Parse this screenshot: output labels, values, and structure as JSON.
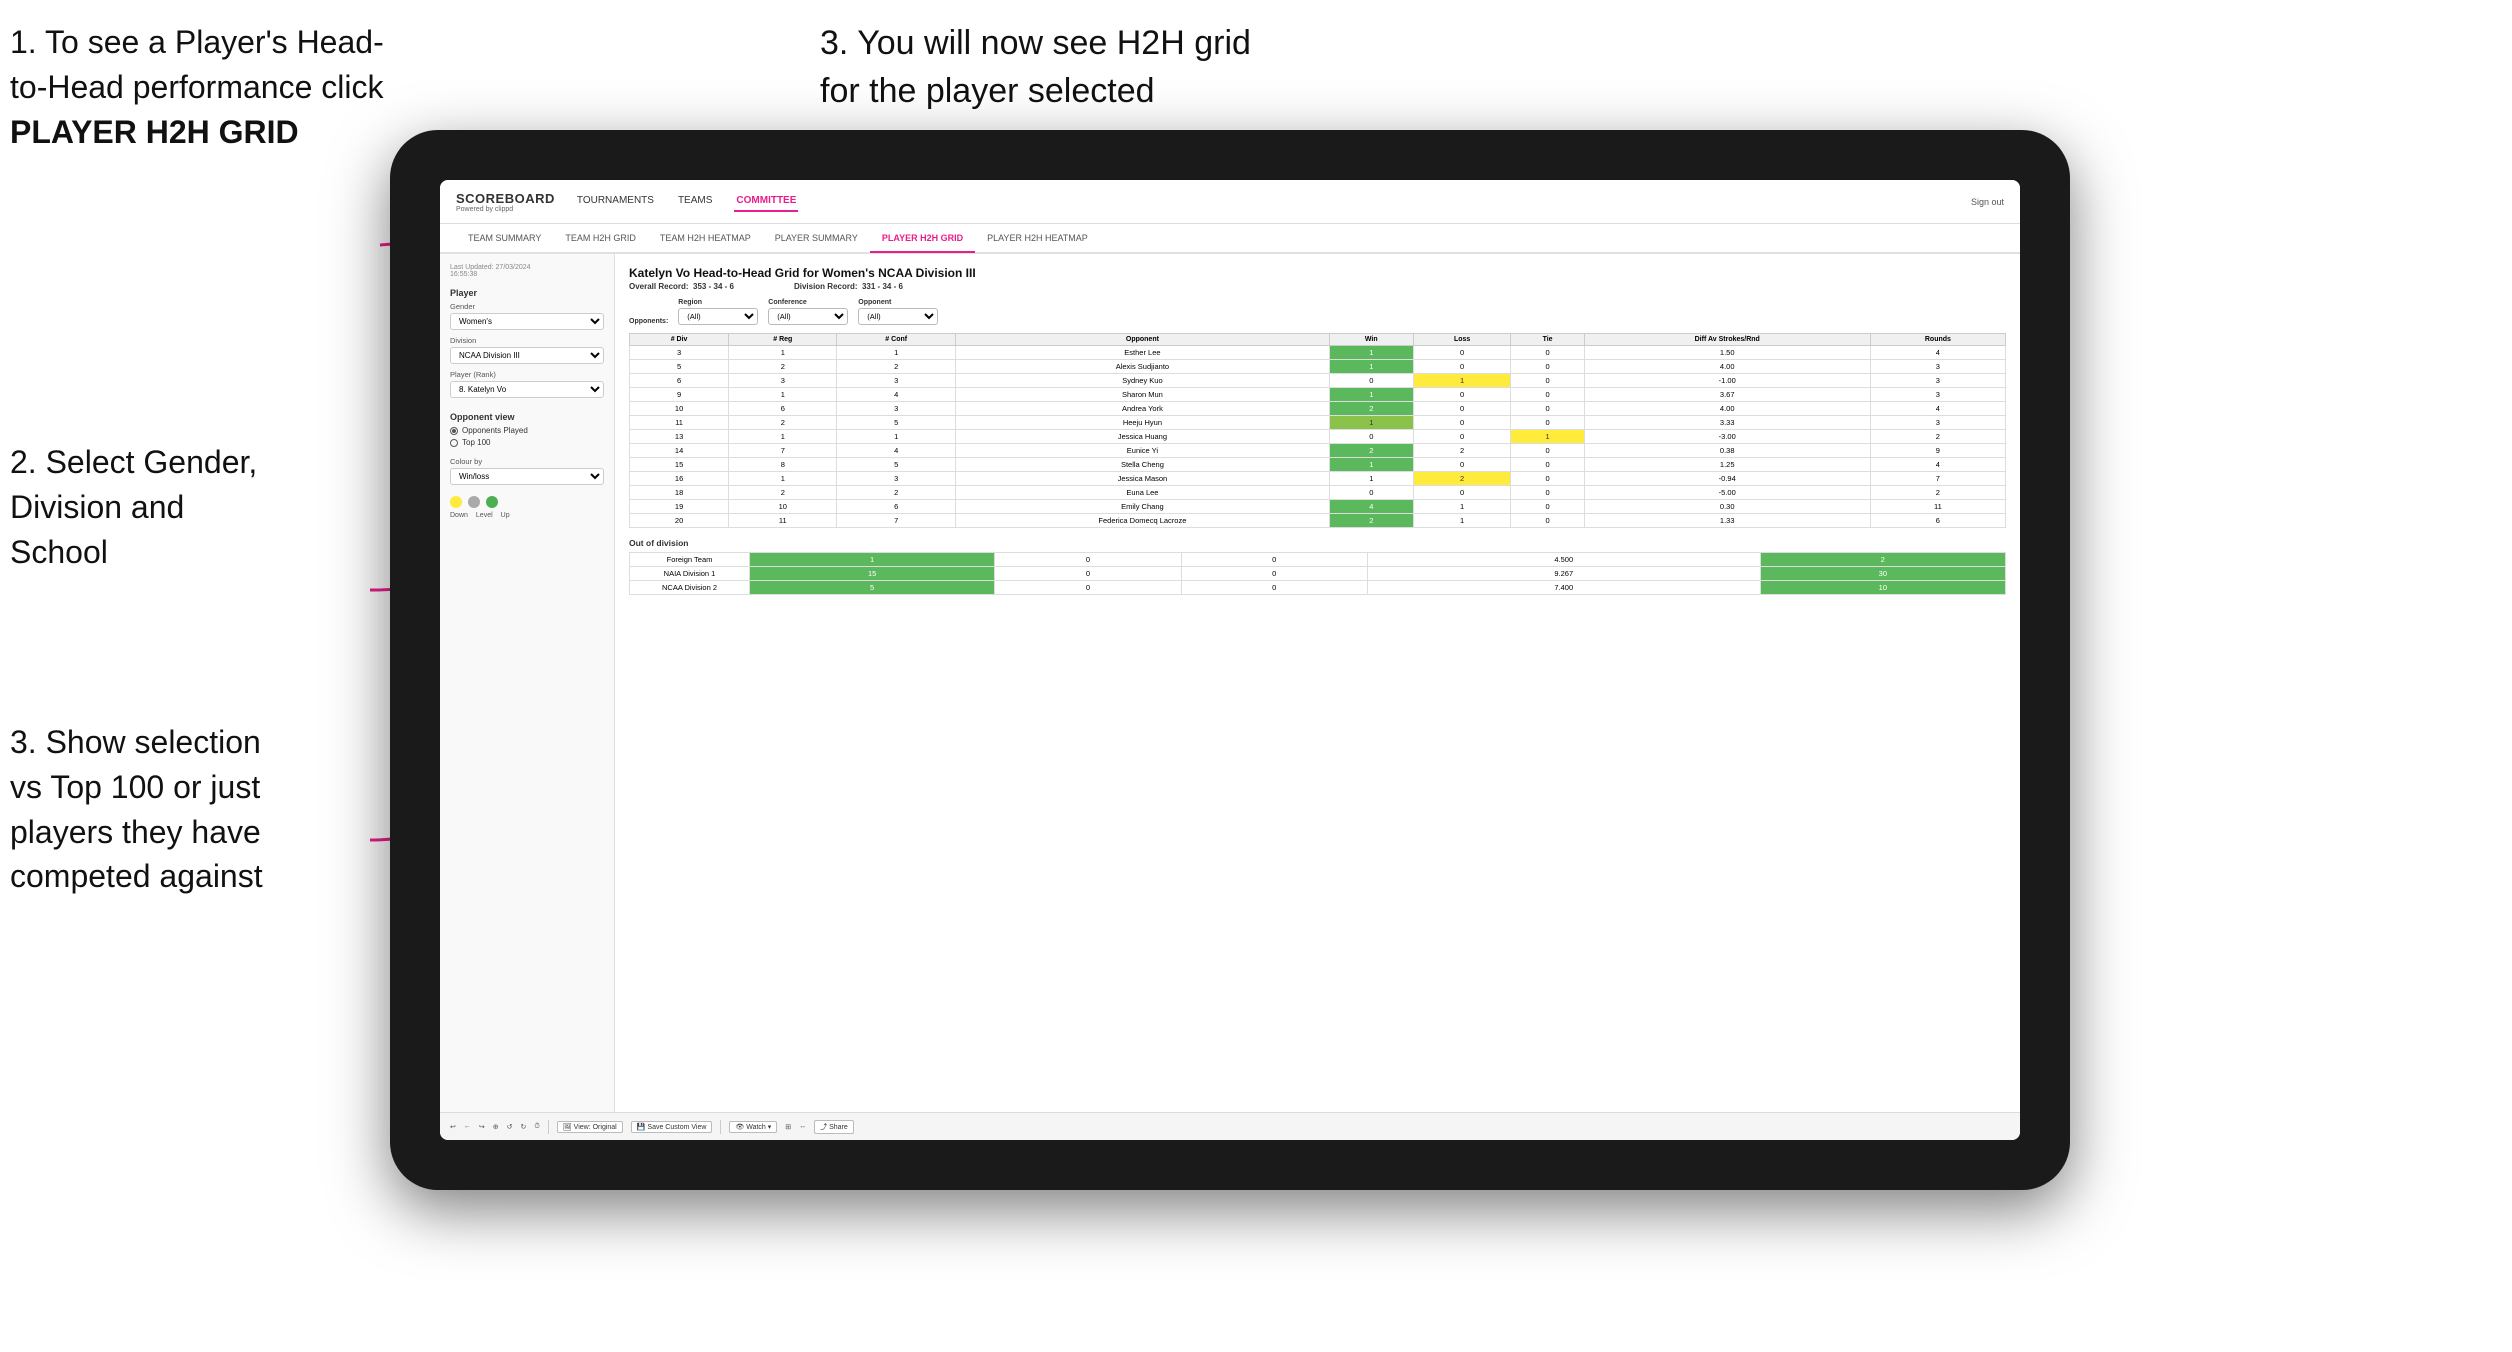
{
  "annotations": {
    "top_left": {
      "line1": "1. To see a Player's Head-",
      "line2": "to-Head performance click",
      "line3": "PLAYER H2H GRID"
    },
    "top_right": {
      "line1": "3. You will now see H2H grid",
      "line2": "for the player selected"
    },
    "mid_left": {
      "text": "2. Select Gender,\nDivision and\nSchool"
    },
    "bottom_left": {
      "line1": "3. Show selection",
      "line2": "vs Top 100 or just",
      "line3": "players they have",
      "line4": "competed against"
    }
  },
  "navbar": {
    "logo": "SCOREBOARD",
    "logo_sub": "Powered by clippd",
    "links": [
      "TOURNAMENTS",
      "TEAMS",
      "COMMITTEE"
    ],
    "active_link": "COMMITTEE",
    "sign_out": "Sign out"
  },
  "subnav": {
    "links": [
      "TEAM SUMMARY",
      "TEAM H2H GRID",
      "TEAM H2H HEATMAP",
      "PLAYER SUMMARY",
      "PLAYER H2H GRID",
      "PLAYER H2H HEATMAP"
    ],
    "active": "PLAYER H2H GRID"
  },
  "sidebar": {
    "timestamp": "Last Updated: 27/03/2024\n16:55:38",
    "player_section": "Player",
    "gender_label": "Gender",
    "gender_value": "Women's",
    "division_label": "Division",
    "division_value": "NCAA Division III",
    "player_rank_label": "Player (Rank)",
    "player_rank_value": "8. Katelyn Vo",
    "opponent_view_title": "Opponent view",
    "radio_options": [
      "Opponents Played",
      "Top 100"
    ],
    "radio_selected": "Opponents Played",
    "colour_by_label": "Colour by",
    "colour_by_value": "Win/loss",
    "legend_down": "Down",
    "legend_level": "Level",
    "legend_up": "Up"
  },
  "main": {
    "title": "Katelyn Vo Head-to-Head Grid for Women's NCAA Division III",
    "overall_record_label": "Overall Record:",
    "overall_record": "353 - 34 - 6",
    "division_record_label": "Division Record:",
    "division_record": "331 - 34 - 6",
    "filters": {
      "opponents_label": "Opponents:",
      "region_label": "Region",
      "conference_label": "Conference",
      "opponent_label": "Opponent",
      "region_value": "(All)",
      "conference_value": "(All)",
      "opponent_value": "(All)"
    },
    "table_headers": [
      "# Div",
      "# Reg",
      "# Conf",
      "Opponent",
      "Win",
      "Loss",
      "Tie",
      "Diff Av Strokes/Rnd",
      "Rounds"
    ],
    "rows": [
      {
        "div": "3",
        "reg": "1",
        "conf": "1",
        "opponent": "Esther Lee",
        "win": "1",
        "loss": "0",
        "tie": "0",
        "diff": "1.50",
        "rounds": "4",
        "win_color": "green",
        "loss_color": "",
        "tie_color": ""
      },
      {
        "div": "5",
        "reg": "2",
        "conf": "2",
        "opponent": "Alexis Sudjianto",
        "win": "1",
        "loss": "0",
        "tie": "0",
        "diff": "4.00",
        "rounds": "3",
        "win_color": "green",
        "loss_color": "",
        "tie_color": ""
      },
      {
        "div": "6",
        "reg": "3",
        "conf": "3",
        "opponent": "Sydney Kuo",
        "win": "0",
        "loss": "1",
        "tie": "0",
        "diff": "-1.00",
        "rounds": "3",
        "win_color": "",
        "loss_color": "yellow",
        "tie_color": ""
      },
      {
        "div": "9",
        "reg": "1",
        "conf": "4",
        "opponent": "Sharon Mun",
        "win": "1",
        "loss": "0",
        "tie": "0",
        "diff": "3.67",
        "rounds": "3",
        "win_color": "green",
        "loss_color": "",
        "tie_color": ""
      },
      {
        "div": "10",
        "reg": "6",
        "conf": "3",
        "opponent": "Andrea York",
        "win": "2",
        "loss": "0",
        "tie": "0",
        "diff": "4.00",
        "rounds": "4",
        "win_color": "green",
        "loss_color": "",
        "tie_color": ""
      },
      {
        "div": "11",
        "reg": "2",
        "conf": "5",
        "opponent": "Heeju Hyun",
        "win": "1",
        "loss": "0",
        "tie": "0",
        "diff": "3.33",
        "rounds": "3",
        "win_color": "green",
        "loss_color": "",
        "tie_color": ""
      },
      {
        "div": "13",
        "reg": "1",
        "conf": "1",
        "opponent": "Jessica Huang",
        "win": "0",
        "loss": "0",
        "tie": "1",
        "diff": "-3.00",
        "rounds": "2",
        "win_color": "",
        "loss_color": "",
        "tie_color": "yellow"
      },
      {
        "div": "14",
        "reg": "7",
        "conf": "4",
        "opponent": "Eunice Yi",
        "win": "2",
        "loss": "2",
        "tie": "0",
        "diff": "0.38",
        "rounds": "9",
        "win_color": "green",
        "loss_color": "",
        "tie_color": ""
      },
      {
        "div": "15",
        "reg": "8",
        "conf": "5",
        "opponent": "Stella Cheng",
        "win": "1",
        "loss": "0",
        "tie": "0",
        "diff": "1.25",
        "rounds": "4",
        "win_color": "green",
        "loss_color": "",
        "tie_color": ""
      },
      {
        "div": "16",
        "reg": "1",
        "conf": "3",
        "opponent": "Jessica Mason",
        "win": "1",
        "loss": "2",
        "tie": "0",
        "diff": "-0.94",
        "rounds": "7",
        "win_color": "",
        "loss_color": "yellow",
        "tie_color": ""
      },
      {
        "div": "18",
        "reg": "2",
        "conf": "2",
        "opponent": "Euna Lee",
        "win": "0",
        "loss": "0",
        "tie": "0",
        "diff": "-5.00",
        "rounds": "2",
        "win_color": "",
        "loss_color": "",
        "tie_color": ""
      },
      {
        "div": "19",
        "reg": "10",
        "conf": "6",
        "opponent": "Emily Chang",
        "win": "4",
        "loss": "1",
        "tie": "0",
        "diff": "0.30",
        "rounds": "11",
        "win_color": "green",
        "loss_color": "",
        "tie_color": ""
      },
      {
        "div": "20",
        "reg": "11",
        "conf": "7",
        "opponent": "Federica Domecq Lacroze",
        "win": "2",
        "loss": "1",
        "tie": "0",
        "diff": "1.33",
        "rounds": "6",
        "win_color": "green",
        "loss_color": "",
        "tie_color": ""
      }
    ],
    "out_of_division_title": "Out of division",
    "out_of_division_rows": [
      {
        "team": "Foreign Team",
        "win": "1",
        "loss": "0",
        "tie": "0",
        "diff": "4.500",
        "rounds": "2"
      },
      {
        "team": "NAIA Division 1",
        "win": "15",
        "loss": "0",
        "tie": "0",
        "diff": "9.267",
        "rounds": "30"
      },
      {
        "team": "NCAA Division 2",
        "win": "5",
        "loss": "0",
        "tie": "0",
        "diff": "7.400",
        "rounds": "10"
      }
    ]
  },
  "toolbar": {
    "buttons": [
      "↩",
      "←",
      "↪",
      "⊕",
      "↺",
      "↻",
      "⏱"
    ],
    "view_original": "View: Original",
    "save_custom": "Save Custom View",
    "watch": "Watch ▾",
    "share": "Share"
  }
}
